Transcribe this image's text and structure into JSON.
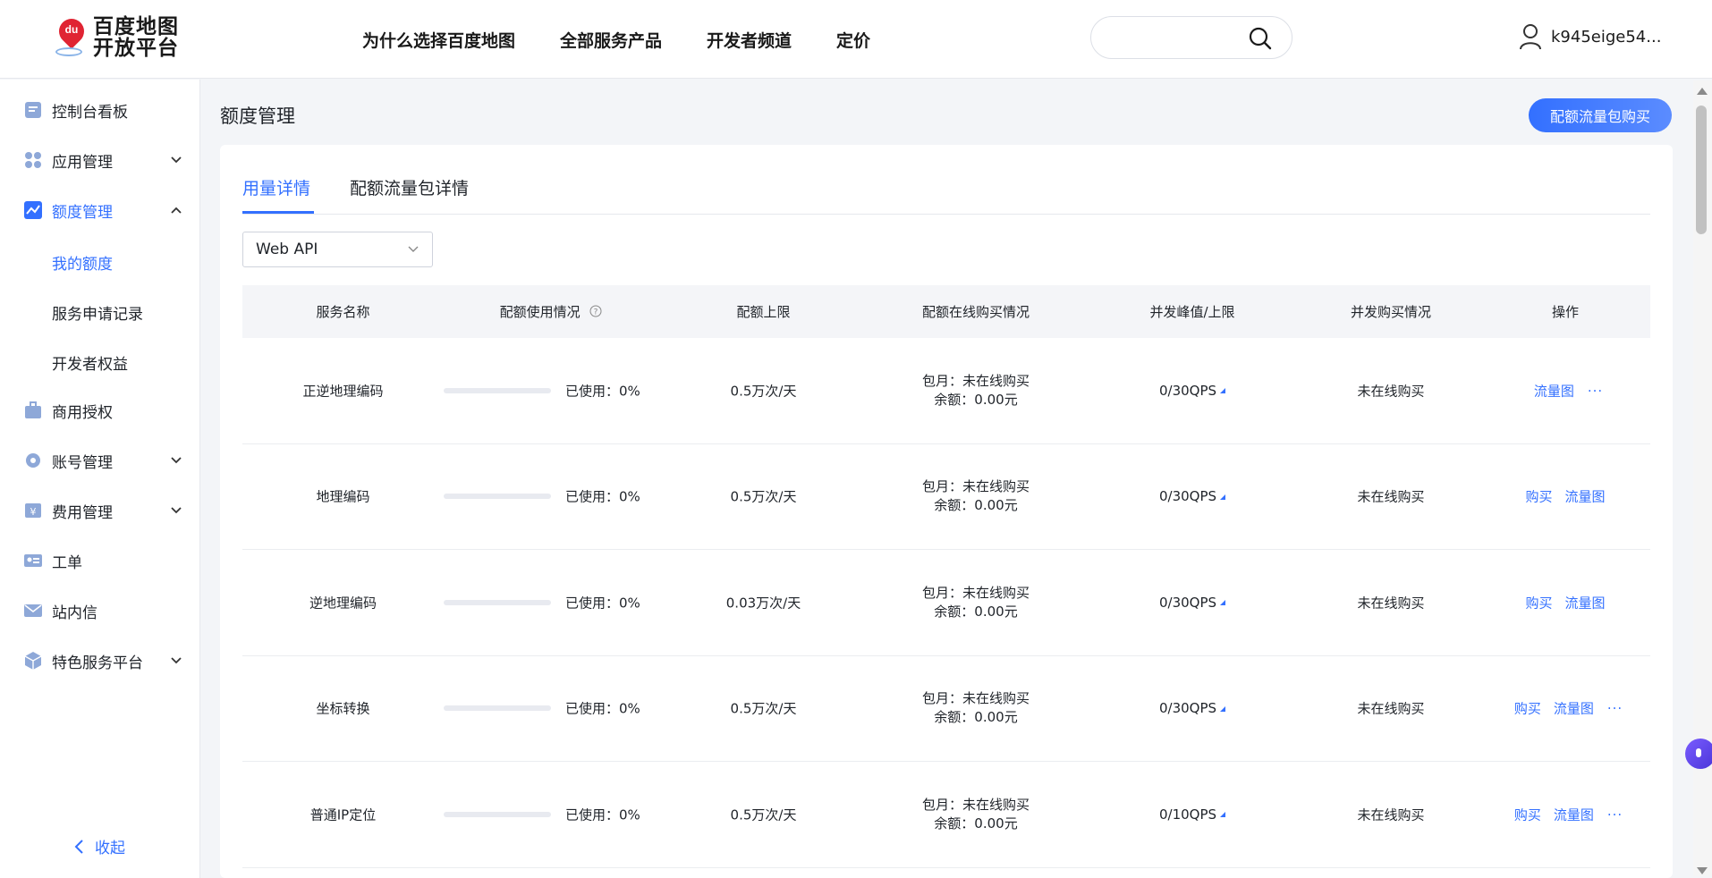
{
  "logo": {
    "badge": "du",
    "line1": "百度地图",
    "line2": "开放平台"
  },
  "nav": [
    "为什么选择百度地图",
    "全部服务产品",
    "开发者频道",
    "定价"
  ],
  "search": {
    "placeholder": ""
  },
  "user": {
    "name": "k945eige54..."
  },
  "sidebar": {
    "items": [
      {
        "label": "控制台看板",
        "icon": "dashboard-icon",
        "expandable": false
      },
      {
        "label": "应用管理",
        "icon": "apps-icon",
        "expandable": true,
        "expanded": false
      },
      {
        "label": "额度管理",
        "icon": "chart-icon",
        "expandable": true,
        "expanded": true,
        "active": true
      },
      {
        "label": "商用授权",
        "icon": "briefcase-icon",
        "expandable": false
      },
      {
        "label": "账号管理",
        "icon": "gear-icon",
        "expandable": true,
        "expanded": false
      },
      {
        "label": "费用管理",
        "icon": "yen-icon",
        "expandable": true,
        "expanded": false
      },
      {
        "label": "工单",
        "icon": "id-card-icon",
        "expandable": false
      },
      {
        "label": "站内信",
        "icon": "mail-icon",
        "expandable": false
      },
      {
        "label": "特色服务平台",
        "icon": "cube-icon",
        "expandable": true,
        "expanded": false
      }
    ],
    "sub_items": [
      "我的额度",
      "服务申请记录",
      "开发者权益"
    ],
    "collapse_label": "收起"
  },
  "page": {
    "title": "额度管理",
    "buy_button": "配额流量包购买",
    "tabs": [
      "用量详情",
      "配额流量包详情"
    ],
    "select_value": "Web API"
  },
  "table": {
    "headers": [
      "服务名称",
      "配额使用情况",
      "配额上限",
      "配额在线购买情况",
      "并发峰值/上限",
      "并发购买情况",
      "操作"
    ],
    "rows": [
      {
        "name": "正逆地理编码",
        "used": "已使用：0%",
        "used_fraction": 0,
        "limit": "0.5万次/天",
        "buy_month": "包月：未在线购买",
        "balance": "余额：0.00元",
        "qps": "0/30QPS",
        "qps_buy": "未在线购买",
        "ops": [
          "流量图"
        ],
        "more": true
      },
      {
        "name": "地理编码",
        "used": "已使用：0%",
        "used_fraction": 0,
        "limit": "0.5万次/天",
        "buy_month": "包月：未在线购买",
        "balance": "余额：0.00元",
        "qps": "0/30QPS",
        "qps_buy": "未在线购买",
        "ops": [
          "购买",
          "流量图"
        ],
        "more": false
      },
      {
        "name": "逆地理编码",
        "used": "已使用：0%",
        "used_fraction": 0,
        "limit": "0.03万次/天",
        "buy_month": "包月：未在线购买",
        "balance": "余额：0.00元",
        "qps": "0/30QPS",
        "qps_buy": "未在线购买",
        "ops": [
          "购买",
          "流量图"
        ],
        "more": false
      },
      {
        "name": "坐标转换",
        "used": "已使用：0%",
        "used_fraction": 0,
        "limit": "0.5万次/天",
        "buy_month": "包月：未在线购买",
        "balance": "余额：0.00元",
        "qps": "0/30QPS",
        "qps_buy": "未在线购买",
        "ops": [
          "购买",
          "流量图"
        ],
        "more": true
      },
      {
        "name": "普通IP定位",
        "used": "已使用：0%",
        "used_fraction": 0,
        "limit": "0.5万次/天",
        "buy_month": "包月：未在线购买",
        "balance": "余额：0.00元",
        "qps": "0/10QPS",
        "qps_buy": "未在线购买",
        "ops": [
          "购买",
          "流量图"
        ],
        "more": true
      }
    ],
    "more_symbol": "···"
  },
  "colors": {
    "accent": "#3370ff",
    "logo_red": "#e02433"
  }
}
